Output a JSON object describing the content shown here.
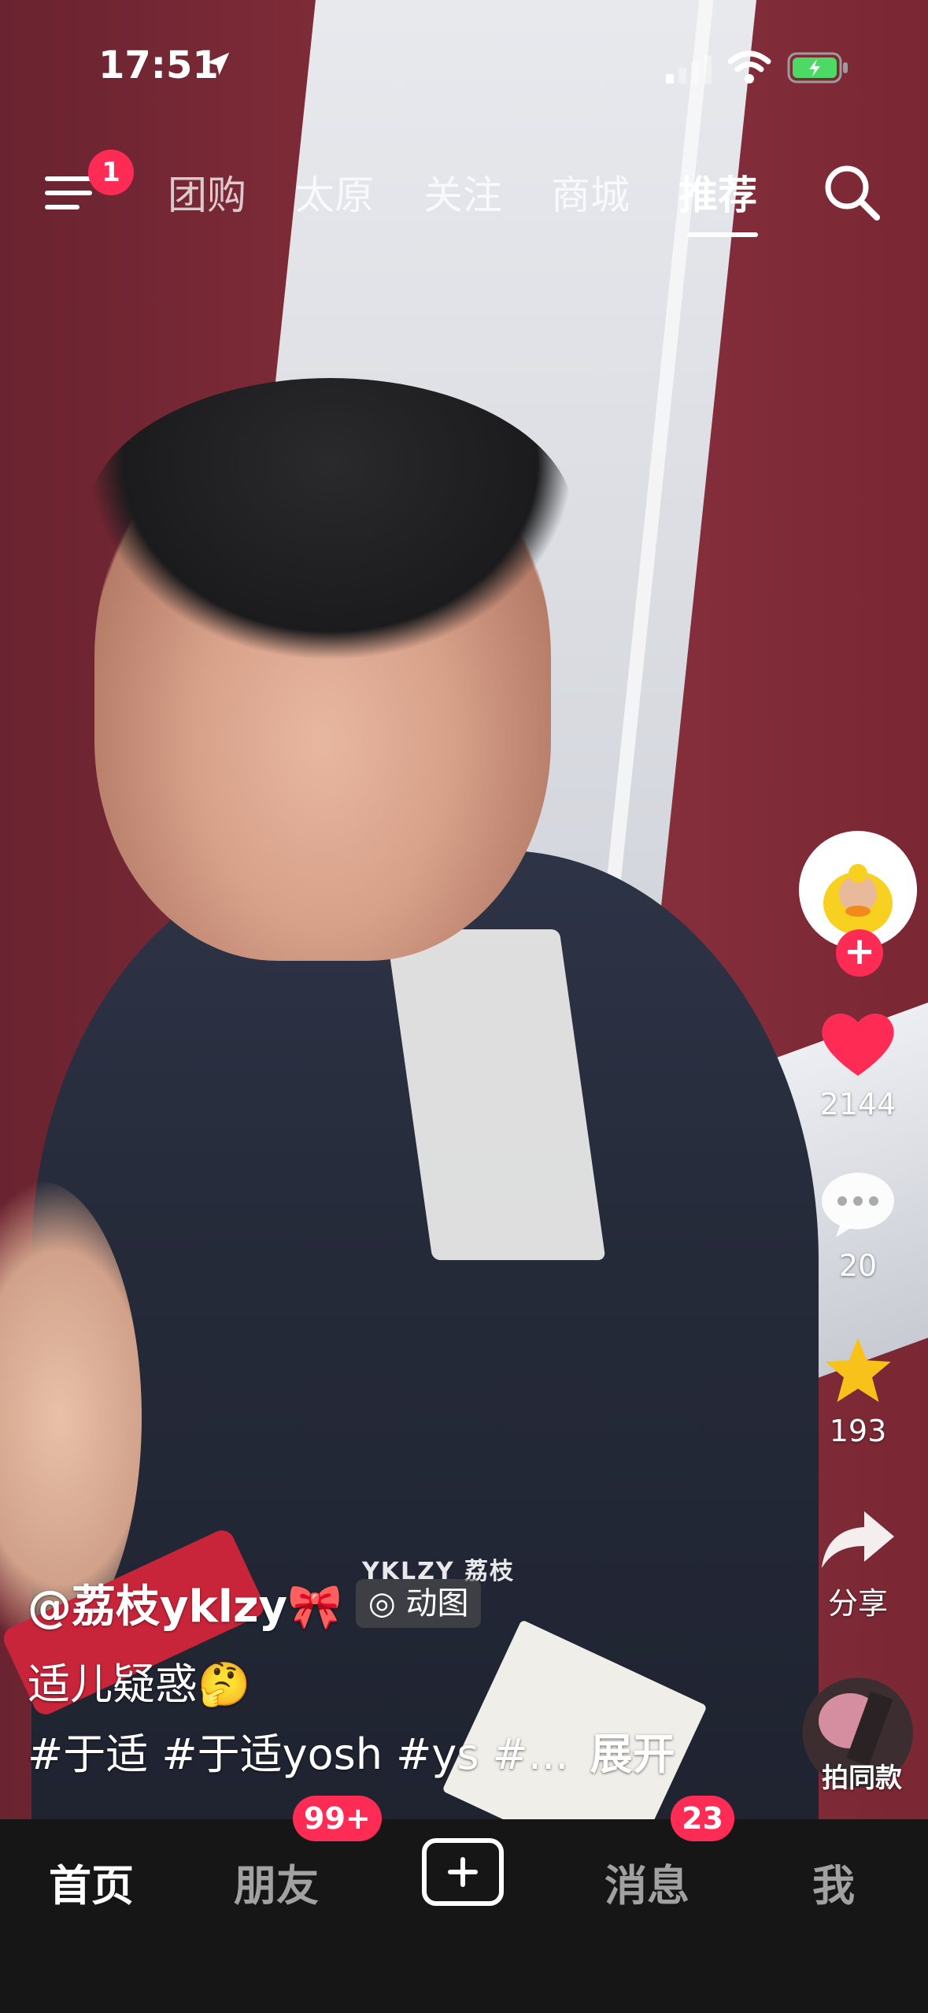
{
  "status_bar": {
    "time": "17:51"
  },
  "top_nav": {
    "menu_badge": "1",
    "tabs": [
      "团购",
      "太原",
      "关注",
      "商城",
      "推荐"
    ],
    "active_tab": "推荐"
  },
  "video": {
    "watermark": "YKLZY 荔枝",
    "author": "@荔枝yklzy🎀",
    "motion_chip": "动图",
    "description": "适儿疑惑🤔",
    "tags": "#于适 #于适yosh #ys #...",
    "expand": "展开"
  },
  "right_actions": {
    "likes": "2144",
    "comments": "20",
    "favorites": "193",
    "share_label": "分享",
    "same_style_label": "拍同款"
  },
  "bottom_nav": {
    "home": "首页",
    "friends": "朋友",
    "friends_badge": "99+",
    "messages": "消息",
    "messages_badge": "23",
    "me": "我"
  },
  "colors": {
    "accent": "#fe2c55",
    "star": "#f8c21b"
  }
}
